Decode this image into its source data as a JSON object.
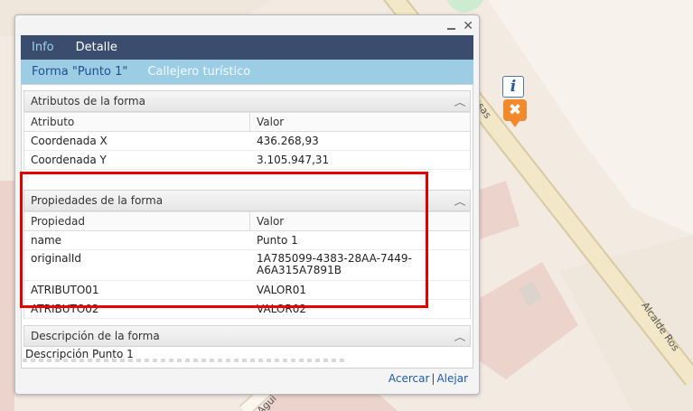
{
  "map": {
    "road_labels": [
      "Rosas",
      "Alcalde Ros",
      "Agui"
    ]
  },
  "window": {
    "minimize_icon": "minimize-icon",
    "close_icon": "close-icon",
    "close_glyph": "✕"
  },
  "tabs": [
    {
      "label": "Info",
      "active": true
    },
    {
      "label": "Detalle",
      "active": false
    }
  ],
  "subtabs": [
    {
      "label": "Forma \"Punto 1\"",
      "active": true
    },
    {
      "label": "Callejero turístico",
      "active": false
    }
  ],
  "attributes_section": {
    "title": "Atributos de la forma",
    "col1": "Atributo",
    "col2": "Valor",
    "rows": [
      {
        "name": "Coordenada X",
        "value": "436.268,93"
      },
      {
        "name": "Coordenada Y",
        "value": "3.105.947,31"
      }
    ]
  },
  "properties_section": {
    "title": "Propiedades de la forma",
    "col1": "Propiedad",
    "col2": "Valor",
    "rows": [
      {
        "name": "name",
        "value": "Punto 1"
      },
      {
        "name": "originalId",
        "value_line1": "1A785099-4383-28AA-7449-",
        "value_line2": "A6A315A7891B"
      },
      {
        "name": "ATRIBUTO01",
        "value": "VALOR01"
      },
      {
        "name": "ATRIBUTO02",
        "value": "VALOR02"
      }
    ]
  },
  "description_section": {
    "title": "Descripción de la forma",
    "text": "Descripción Punto 1"
  },
  "footer": {
    "zoom_in": "Acercar",
    "separator": "|",
    "zoom_out": "Alejar"
  },
  "markers": {
    "info_glyph": "i",
    "remove_glyph": "✖"
  },
  "colors": {
    "tab_bar": "#3a4d6f",
    "subtab_bar": "#9ccde5",
    "highlight": "#e50000",
    "marker_orange": "#f28a2c"
  }
}
